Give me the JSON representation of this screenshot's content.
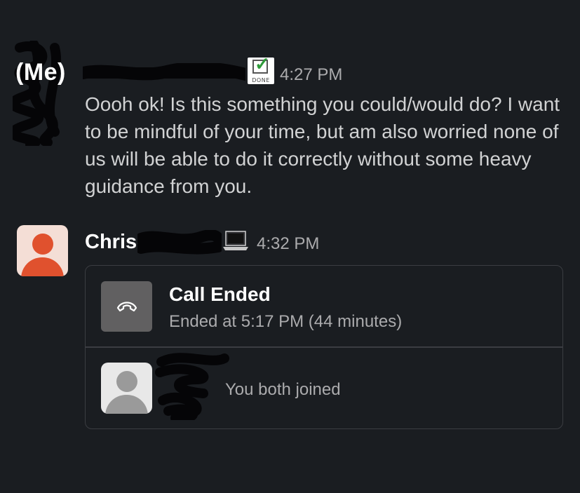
{
  "message1": {
    "label": "(Me)",
    "badge_text": "DONE",
    "time": "4:27 PM",
    "text": "Oooh ok! Is this something you could/would do? I want to be mindful of your time, but am also worried none of us will be able to do it correctly without some heavy guidance from you."
  },
  "message2": {
    "sender": "Chris",
    "status_icon": "laptop-icon",
    "time": "4:32 PM",
    "call": {
      "title": "Call Ended",
      "subtitle": "Ended at 5:17 PM (44 minutes)",
      "participants_text": "You both joined"
    }
  },
  "colors": {
    "background": "#1a1d21",
    "avatar_accent": "#e0512e",
    "done_check": "#2e9b39"
  }
}
